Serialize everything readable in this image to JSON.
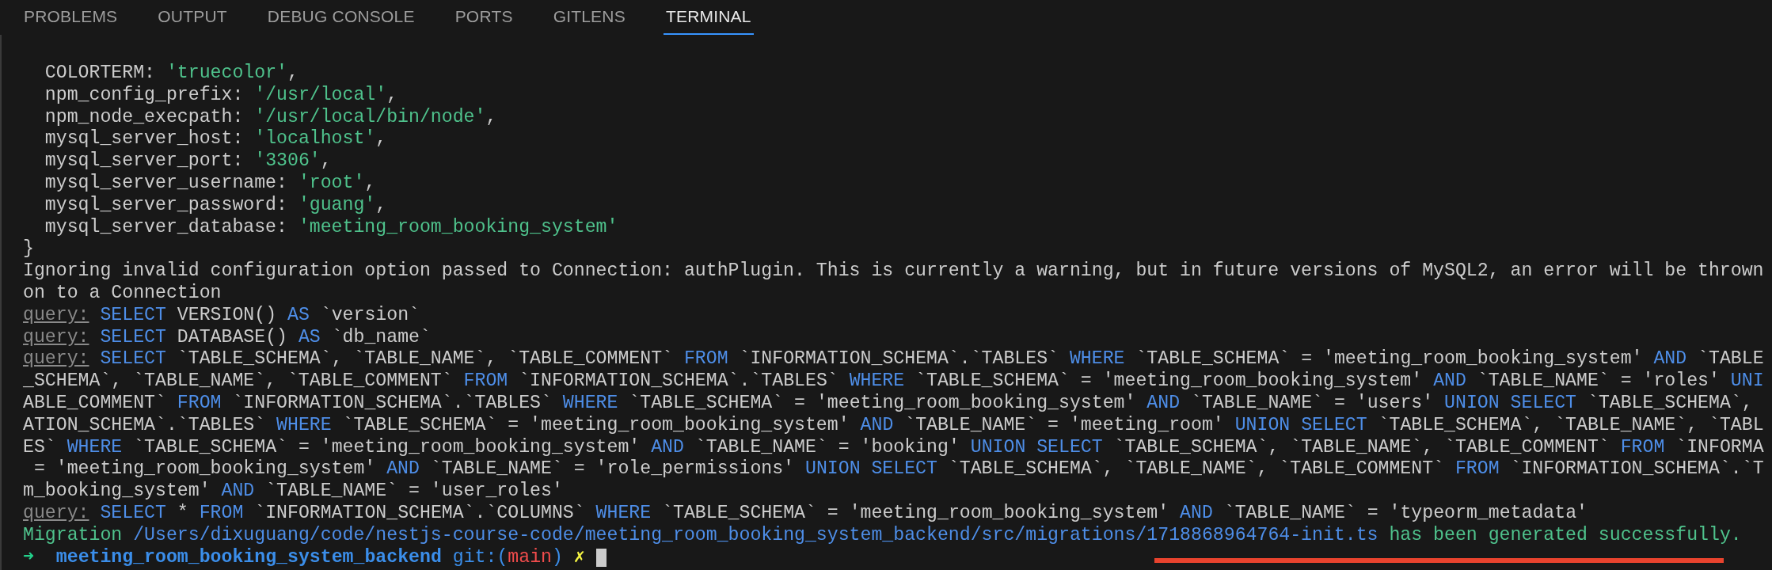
{
  "tabs": [
    {
      "label": "PROBLEMS",
      "selected": false
    },
    {
      "label": "OUTPUT",
      "selected": false
    },
    {
      "label": "DEBUG CONSOLE",
      "selected": false
    },
    {
      "label": "PORTS",
      "selected": false
    },
    {
      "label": "GITLENS",
      "selected": false
    },
    {
      "label": "TERMINAL",
      "selected": true
    }
  ],
  "terminal": {
    "lines": [
      {
        "segments": [
          {
            "kind": "text",
            "text": "  COLORTERM: "
          },
          {
            "kind": "string",
            "text": "'truecolor'"
          },
          {
            "kind": "text",
            "text": ","
          }
        ]
      },
      {
        "segments": [
          {
            "kind": "text",
            "text": "  npm_config_prefix: "
          },
          {
            "kind": "string",
            "text": "'/usr/local'"
          },
          {
            "kind": "text",
            "text": ","
          }
        ]
      },
      {
        "segments": [
          {
            "kind": "text",
            "text": "  npm_node_execpath: "
          },
          {
            "kind": "string",
            "text": "'/usr/local/bin/node'"
          },
          {
            "kind": "text",
            "text": ","
          }
        ]
      },
      {
        "segments": [
          {
            "kind": "text",
            "text": "  mysql_server_host: "
          },
          {
            "kind": "string",
            "text": "'localhost'"
          },
          {
            "kind": "text",
            "text": ","
          }
        ]
      },
      {
        "segments": [
          {
            "kind": "text",
            "text": "  mysql_server_port: "
          },
          {
            "kind": "string",
            "text": "'3306'"
          },
          {
            "kind": "text",
            "text": ","
          }
        ]
      },
      {
        "segments": [
          {
            "kind": "text",
            "text": "  mysql_server_username: "
          },
          {
            "kind": "string",
            "text": "'root'"
          },
          {
            "kind": "text",
            "text": ","
          }
        ]
      },
      {
        "segments": [
          {
            "kind": "text",
            "text": "  mysql_server_password: "
          },
          {
            "kind": "string",
            "text": "'guang'"
          },
          {
            "kind": "text",
            "text": ","
          }
        ]
      },
      {
        "segments": [
          {
            "kind": "text",
            "text": "  mysql_server_database: "
          },
          {
            "kind": "string",
            "text": "'meeting_room_booking_system'"
          }
        ]
      },
      {
        "segments": [
          {
            "kind": "text",
            "text": "}"
          }
        ]
      },
      {
        "segments": [
          {
            "kind": "text",
            "text": "Ignoring invalid configuration option passed to Connection: authPlugin. This is currently a warning, but in future versions of MySQL2, an error will be thrown"
          }
        ]
      },
      {
        "segments": [
          {
            "kind": "text",
            "text": "on to a Connection"
          }
        ]
      },
      {
        "segments": [
          {
            "kind": "label",
            "text": "query:"
          },
          {
            "kind": "keyword",
            "text": " SELECT"
          },
          {
            "kind": "text",
            "text": " VERSION() "
          },
          {
            "kind": "keyword",
            "text": "AS"
          },
          {
            "kind": "text",
            "text": " `version`"
          }
        ]
      },
      {
        "segments": [
          {
            "kind": "label",
            "text": "query:"
          },
          {
            "kind": "keyword",
            "text": " SELECT"
          },
          {
            "kind": "text",
            "text": " DATABASE() "
          },
          {
            "kind": "keyword",
            "text": "AS"
          },
          {
            "kind": "text",
            "text": " `db_name`"
          }
        ]
      },
      {
        "segments": [
          {
            "kind": "label",
            "text": "query:"
          },
          {
            "kind": "keyword",
            "text": " SELECT"
          },
          {
            "kind": "text",
            "text": " `TABLE_SCHEMA`, `TABLE_NAME`, `TABLE_COMMENT` "
          },
          {
            "kind": "keyword",
            "text": "FROM"
          },
          {
            "kind": "text",
            "text": " `INFORMATION_SCHEMA`.`TABLES` "
          },
          {
            "kind": "keyword",
            "text": "WHERE"
          },
          {
            "kind": "text",
            "text": " `TABLE_SCHEMA` = 'meeting_room_booking_system' "
          },
          {
            "kind": "keyword",
            "text": "AND"
          },
          {
            "kind": "text",
            "text": " `TABLE"
          }
        ]
      },
      {
        "segments": [
          {
            "kind": "text",
            "text": "_SCHEMA`, `TABLE_NAME`, `TABLE_COMMENT` "
          },
          {
            "kind": "keyword",
            "text": "FROM"
          },
          {
            "kind": "text",
            "text": " `INFORMATION_SCHEMA`.`TABLES` "
          },
          {
            "kind": "keyword",
            "text": "WHERE"
          },
          {
            "kind": "text",
            "text": " `TABLE_SCHEMA` = 'meeting_room_booking_system' "
          },
          {
            "kind": "keyword",
            "text": "AND"
          },
          {
            "kind": "text",
            "text": " `TABLE_NAME` = 'roles' "
          },
          {
            "kind": "keyword",
            "text": "UNI"
          }
        ]
      },
      {
        "segments": [
          {
            "kind": "text",
            "text": "ABLE_COMMENT` "
          },
          {
            "kind": "keyword",
            "text": "FROM"
          },
          {
            "kind": "text",
            "text": " `INFORMATION_SCHEMA`.`TABLES` "
          },
          {
            "kind": "keyword",
            "text": "WHERE"
          },
          {
            "kind": "text",
            "text": " `TABLE_SCHEMA` = 'meeting_room_booking_system' "
          },
          {
            "kind": "keyword",
            "text": "AND"
          },
          {
            "kind": "text",
            "text": " `TABLE_NAME` = 'users' "
          },
          {
            "kind": "keyword",
            "text": "UNION SELECT"
          },
          {
            "kind": "text",
            "text": " `TABLE_SCHEMA`,"
          }
        ]
      },
      {
        "segments": [
          {
            "kind": "text",
            "text": "ATION_SCHEMA`.`TABLES` "
          },
          {
            "kind": "keyword",
            "text": "WHERE"
          },
          {
            "kind": "text",
            "text": " `TABLE_SCHEMA` = 'meeting_room_booking_system' "
          },
          {
            "kind": "keyword",
            "text": "AND"
          },
          {
            "kind": "text",
            "text": " `TABLE_NAME` = 'meeting_room' "
          },
          {
            "kind": "keyword",
            "text": "UNION SELECT"
          },
          {
            "kind": "text",
            "text": " `TABLE_SCHEMA`, `TABLE_NAME`, `TABL"
          }
        ]
      },
      {
        "segments": [
          {
            "kind": "text",
            "text": "ES` "
          },
          {
            "kind": "keyword",
            "text": "WHERE"
          },
          {
            "kind": "text",
            "text": " `TABLE_SCHEMA` = 'meeting_room_booking_system' "
          },
          {
            "kind": "keyword",
            "text": "AND"
          },
          {
            "kind": "text",
            "text": " `TABLE_NAME` = 'booking' "
          },
          {
            "kind": "keyword",
            "text": "UNION SELECT"
          },
          {
            "kind": "text",
            "text": " `TABLE_SCHEMA`, `TABLE_NAME`, `TABLE_COMMENT` "
          },
          {
            "kind": "keyword",
            "text": "FROM"
          },
          {
            "kind": "text",
            "text": " `INFORMA"
          }
        ]
      },
      {
        "segments": [
          {
            "kind": "text",
            "text": " = 'meeting_room_booking_system' "
          },
          {
            "kind": "keyword",
            "text": "AND"
          },
          {
            "kind": "text",
            "text": " `TABLE_NAME` = 'role_permissions' "
          },
          {
            "kind": "keyword",
            "text": "UNION SELECT"
          },
          {
            "kind": "text",
            "text": " `TABLE_SCHEMA`, `TABLE_NAME`, `TABLE_COMMENT` "
          },
          {
            "kind": "keyword",
            "text": "FROM"
          },
          {
            "kind": "text",
            "text": " `INFORMATION_SCHEMA`.`T"
          }
        ]
      },
      {
        "segments": [
          {
            "kind": "text",
            "text": "m_booking_system' "
          },
          {
            "kind": "keyword",
            "text": "AND"
          },
          {
            "kind": "text",
            "text": " `TABLE_NAME` = 'user_roles'"
          }
        ]
      },
      {
        "segments": [
          {
            "kind": "label",
            "text": "query:"
          },
          {
            "kind": "keyword",
            "text": " SELECT"
          },
          {
            "kind": "text",
            "text": " * "
          },
          {
            "kind": "keyword",
            "text": "FROM"
          },
          {
            "kind": "text",
            "text": " `INFORMATION_SCHEMA`.`COLUMNS` "
          },
          {
            "kind": "keyword",
            "text": "WHERE"
          },
          {
            "kind": "text",
            "text": " `TABLE_SCHEMA` = 'meeting_room_booking_system' "
          },
          {
            "kind": "keyword",
            "text": "AND"
          },
          {
            "kind": "text",
            "text": " `TABLE_NAME` = 'typeorm_metadata'"
          }
        ]
      },
      {
        "segments": [
          {
            "kind": "string",
            "text": "Migration "
          },
          {
            "kind": "path",
            "text": "/Users/dixuguang/code/nestjs-course-code/meeting_room_booking_system_backend/src/migrations/1718868964764-init.ts"
          },
          {
            "kind": "string",
            "text": " has been generated successfully."
          }
        ]
      }
    ],
    "prompt": [
      {
        "kind": "arrow",
        "text": "➜"
      },
      {
        "kind": "dir",
        "text": "  meeting_room_booking_system_backend"
      },
      {
        "kind": "git",
        "text": " git:("
      },
      {
        "kind": "branch",
        "text": "main"
      },
      {
        "kind": "git",
        "text": ")"
      },
      {
        "kind": "dirty",
        "text": " ✗"
      }
    ]
  }
}
